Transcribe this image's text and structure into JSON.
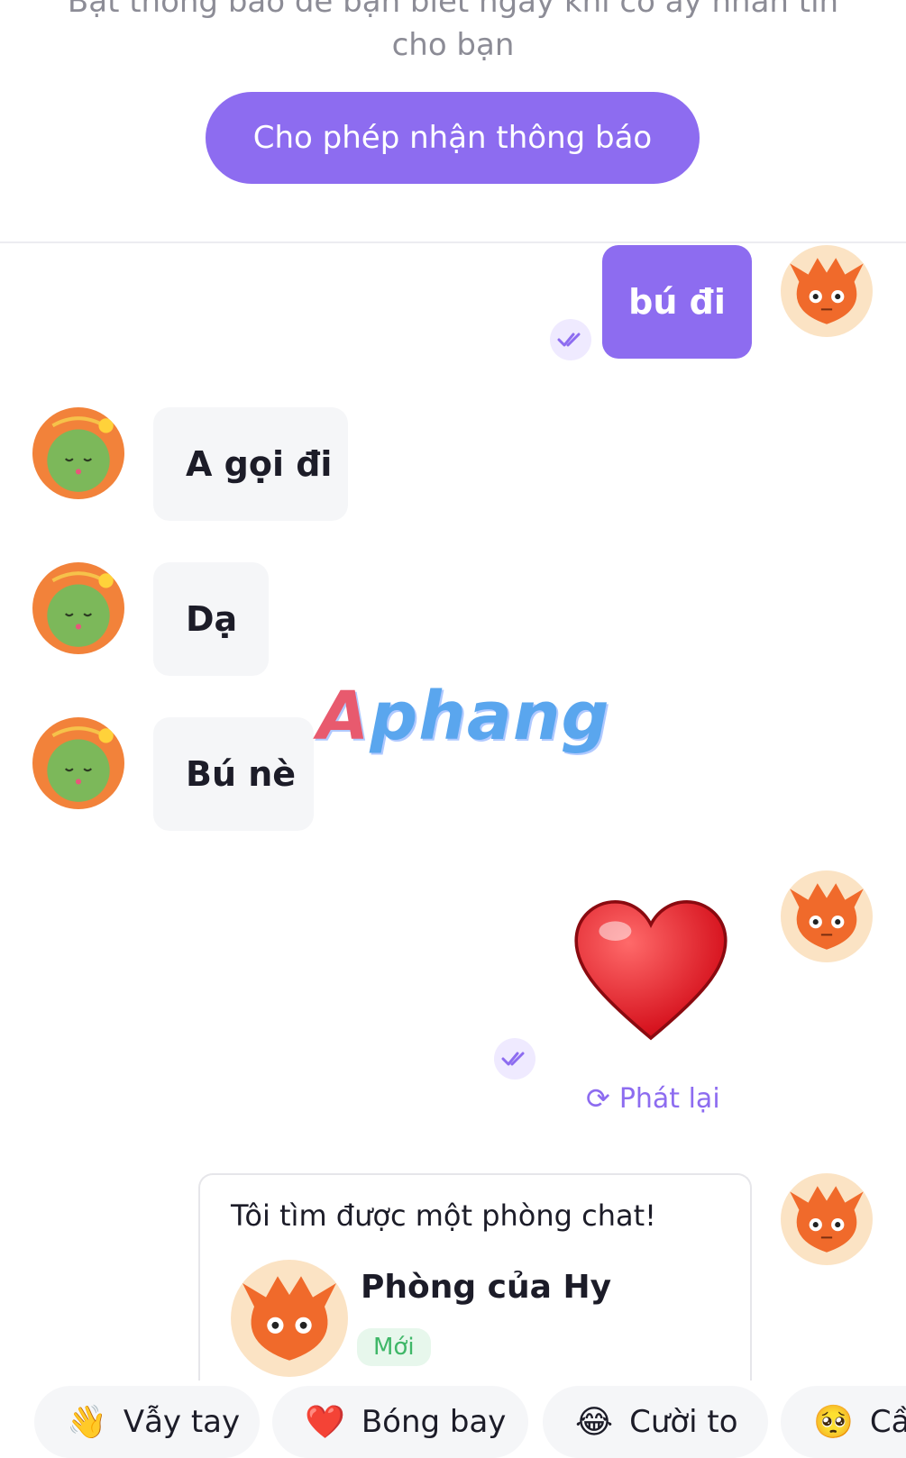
{
  "notification_banner": {
    "text": "Bật thông báo để bạn biết ngay khi cô ấy nhắn tin cho bạn",
    "button_label": "Cho phép nhận thông báo"
  },
  "messages": [
    {
      "direction": "out",
      "text": "bú đi",
      "read": true
    },
    {
      "direction": "in",
      "text": "A gọi đi"
    },
    {
      "direction": "in",
      "text": "Dạ"
    },
    {
      "direction": "in",
      "text": "Bú nè"
    },
    {
      "direction": "out",
      "sticker": "❤️",
      "read": true,
      "replay_label": "Phát lại"
    }
  ],
  "room_card": {
    "title": "Tôi tìm được một phòng chat!",
    "room_name": "Phòng của Hy",
    "badge": "Mới"
  },
  "quick_reactions": [
    {
      "emoji": "👋",
      "label": "Vẫy tay"
    },
    {
      "emoji": "❤️",
      "label": "Bóng bay"
    },
    {
      "emoji": "😂",
      "label": "Cười to"
    },
    {
      "emoji": "🥺",
      "label": "Cầ"
    }
  ],
  "watermark": {
    "text": "Aphang"
  },
  "colors": {
    "accent": "#8d6cf0",
    "incoming_bubble": "#f5f6f8",
    "badge_green": "#3fb768"
  }
}
